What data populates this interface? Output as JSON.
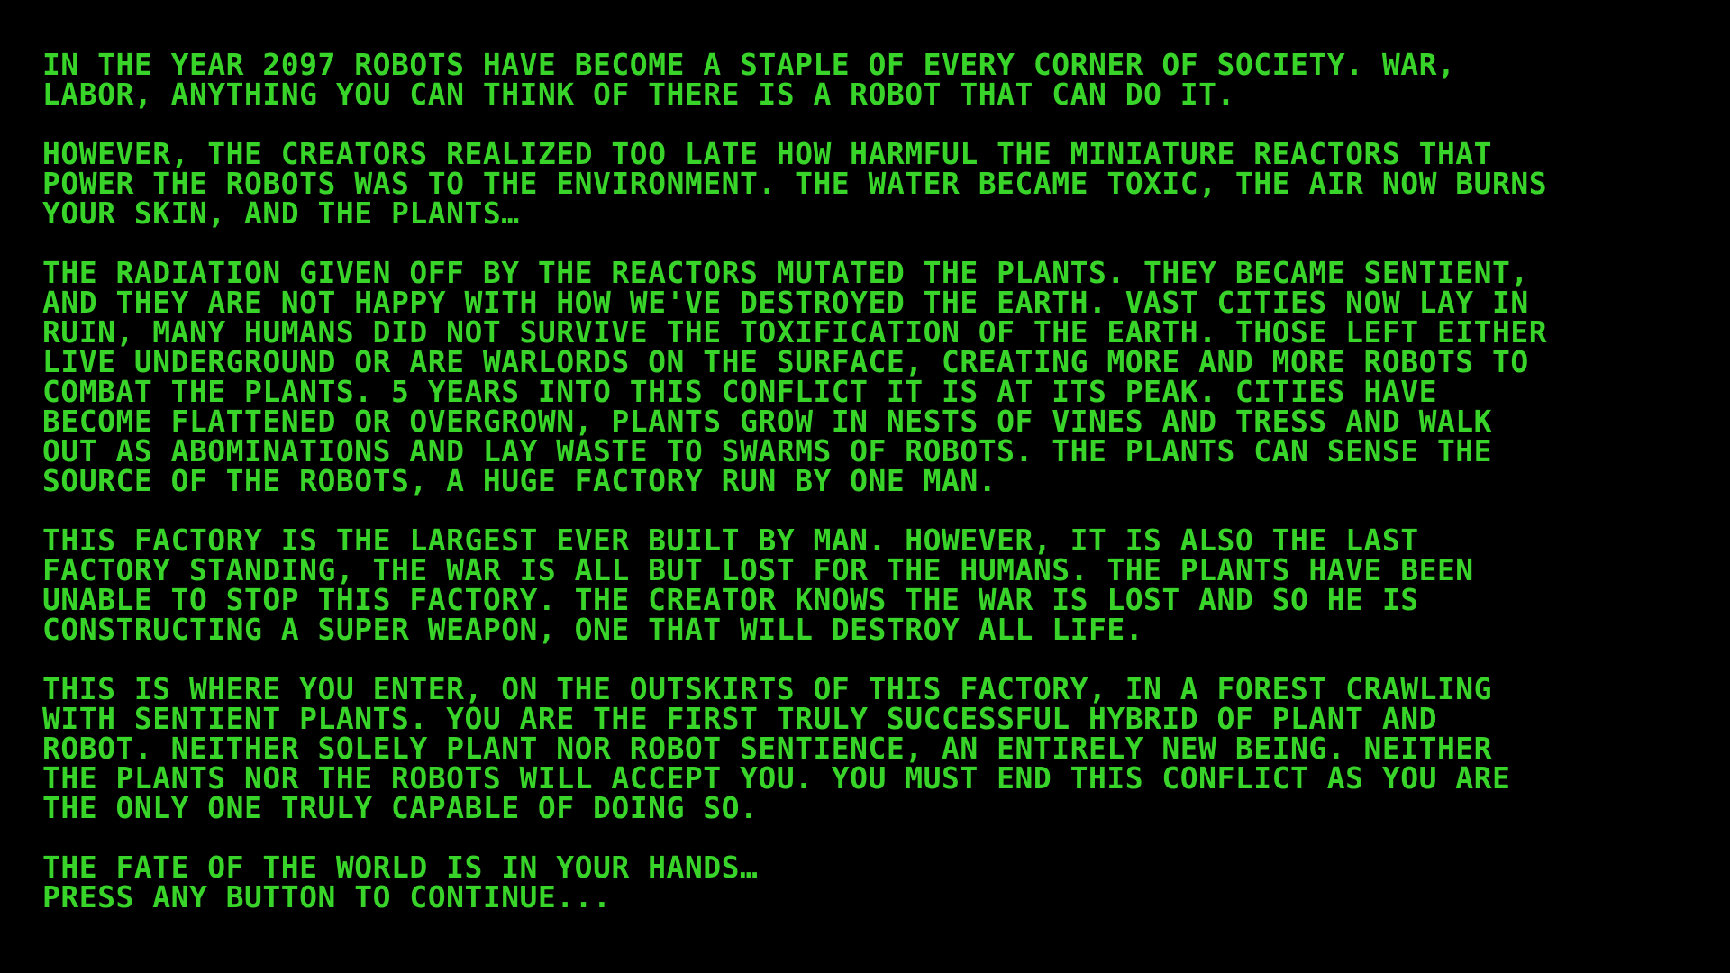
{
  "screen": {
    "text_color": "#39d42a",
    "background_color": "#000000"
  },
  "story": {
    "paragraphs": [
      {
        "lines": [
          "IN THE YEAR 2097 ROBOTS HAVE BECOME A STAPLE OF EVERY CORNER OF SOCIETY. WAR,",
          "LABOR, ANYTHING YOU CAN THINK OF THERE IS A ROBOT THAT CAN DO IT."
        ]
      },
      {
        "lines": [
          "HOWEVER, THE CREATORS REALIZED TOO LATE HOW HARMFUL THE MINIATURE REACTORS THAT",
          "POWER THE ROBOTS WAS TO THE ENVIRONMENT. THE WATER BECAME TOXIC, THE AIR NOW BURNS",
          "YOUR SKIN, AND THE PLANTS…"
        ]
      },
      {
        "lines": [
          "THE RADIATION GIVEN OFF BY THE REACTORS MUTATED THE PLANTS. THEY BECAME SENTIENT,",
          "AND THEY ARE NOT HAPPY WITH HOW WE'VE DESTROYED THE EARTH. VAST CITIES NOW LAY IN",
          "RUIN, MANY HUMANS DID NOT SURVIVE THE TOXIFICATION OF THE EARTH. THOSE LEFT EITHER",
          "LIVE UNDERGROUND OR ARE WARLORDS ON THE SURFACE, CREATING MORE AND MORE ROBOTS TO",
          "COMBAT THE PLANTS. 5 YEARS INTO THIS CONFLICT IT IS AT ITS PEAK. CITIES HAVE",
          "BECOME FLATTENED OR OVERGROWN, PLANTS GROW IN NESTS OF VINES AND TRESS AND WALK",
          "OUT AS ABOMINATIONS AND LAY WASTE TO SWARMS OF ROBOTS. THE PLANTS CAN SENSE THE",
          "SOURCE OF THE ROBOTS, A HUGE FACTORY RUN BY ONE MAN."
        ]
      },
      {
        "lines": [
          "THIS FACTORY IS THE LARGEST EVER BUILT BY MAN. HOWEVER, IT IS ALSO THE LAST",
          "FACTORY STANDING, THE WAR IS ALL BUT LOST FOR THE HUMANS. THE PLANTS HAVE BEEN",
          "UNABLE TO STOP THIS FACTORY. THE CREATOR KNOWS THE WAR IS LOST AND SO HE IS",
          "CONSTRUCTING A SUPER WEAPON, ONE THAT WILL DESTROY ALL LIFE."
        ]
      },
      {
        "lines": [
          "THIS IS WHERE YOU ENTER, ON THE OUTSKIRTS OF THIS FACTORY, IN A FOREST CRAWLING",
          "WITH SENTIENT PLANTS. YOU ARE THE FIRST TRULY SUCCESSFUL HYBRID OF PLANT AND",
          "ROBOT. NEITHER SOLELY PLANT NOR ROBOT SENTIENCE, AN ENTIRELY NEW BEING. NEITHER",
          "THE PLANTS NOR THE ROBOTS WILL ACCEPT YOU. YOU MUST END THIS CONFLICT AS YOU ARE",
          "THE ONLY ONE TRULY CAPABLE OF DOING SO."
        ]
      },
      {
        "lines": [
          "THE FATE OF THE WORLD IS IN YOUR HANDS…",
          "PRESS ANY BUTTON TO CONTINUE..."
        ]
      }
    ]
  }
}
